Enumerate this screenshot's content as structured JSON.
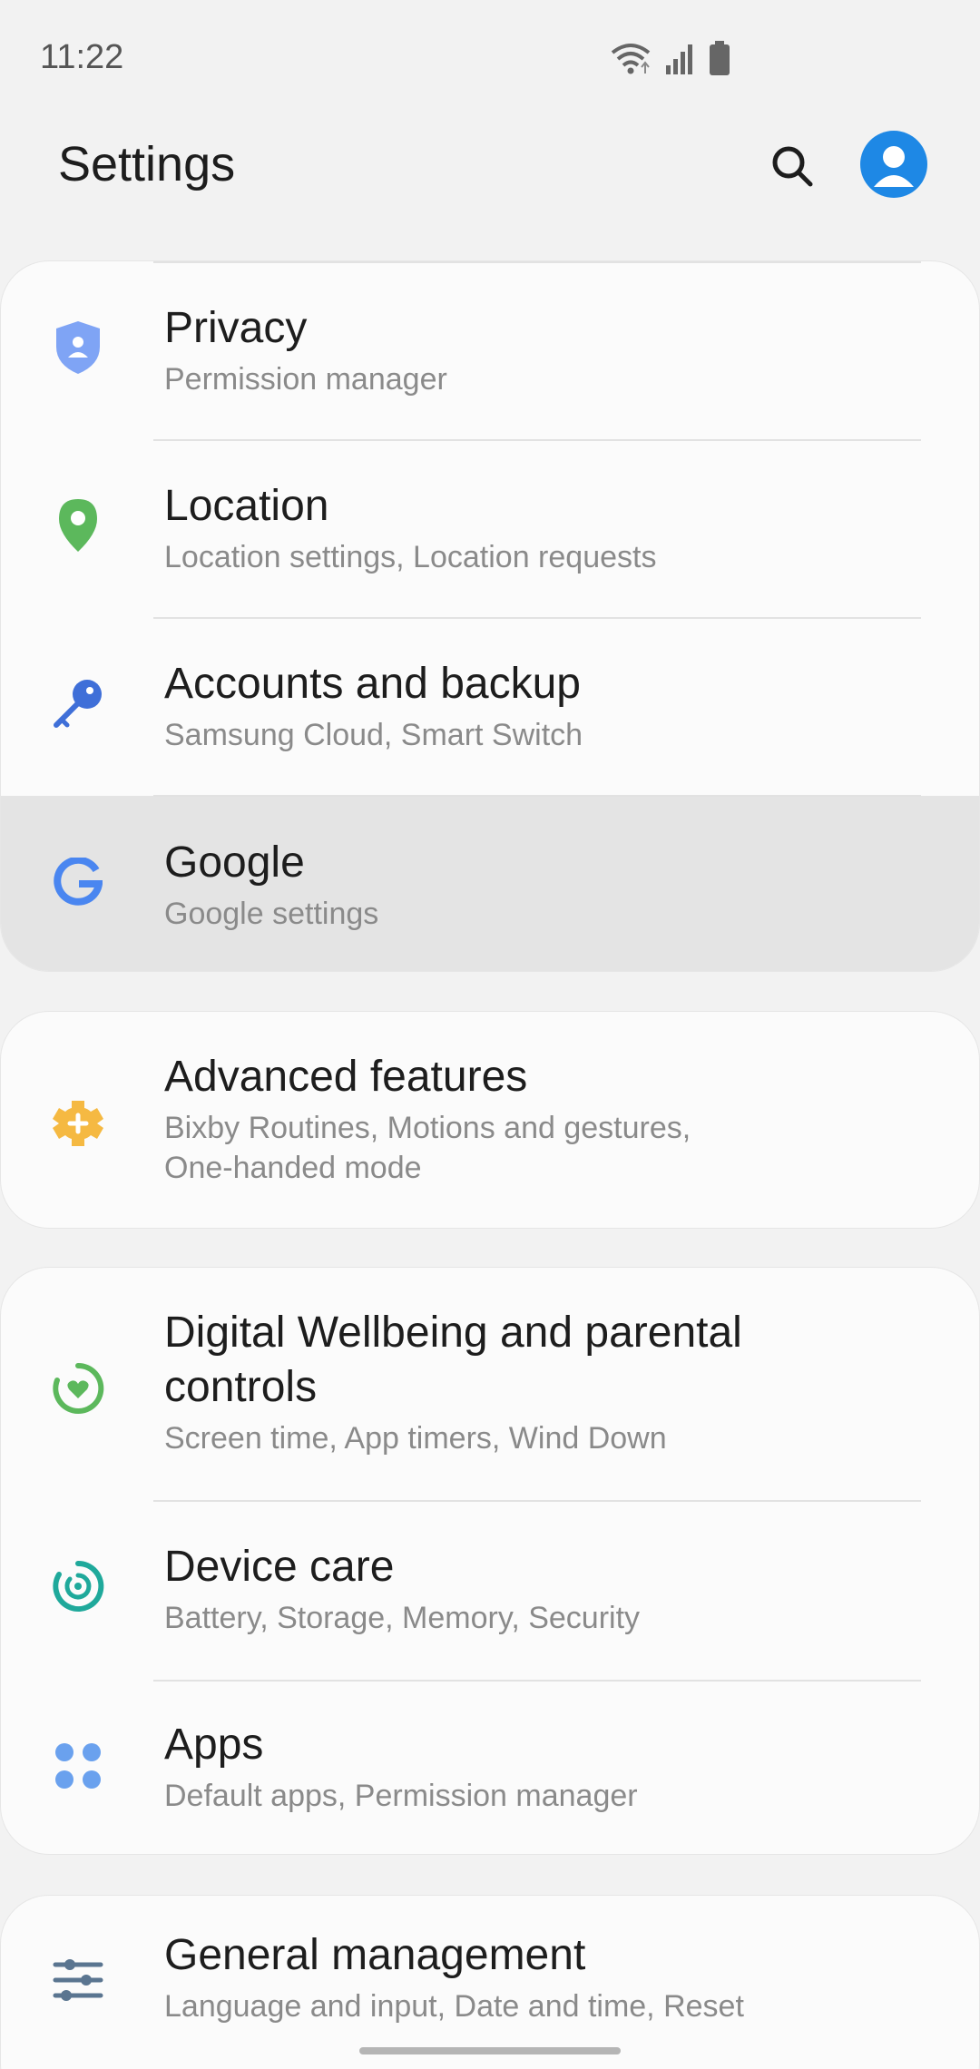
{
  "status_bar": {
    "time": "11:22",
    "icons": [
      "wifi-icon",
      "signal-icon",
      "battery-icon"
    ]
  },
  "header": {
    "title": "Settings",
    "search_icon": "search-icon",
    "avatar_icon": "profile-icon",
    "avatar_color": "#1e88e5"
  },
  "groups": [
    {
      "items": [
        {
          "title": "Privacy",
          "subtitle": "Permission manager",
          "icon": "privacy-shield-icon"
        },
        {
          "title": "Location",
          "subtitle": "Location settings, Location requests",
          "icon": "location-pin-icon"
        },
        {
          "title": "Accounts and backup",
          "subtitle": "Samsung Cloud, Smart Switch",
          "icon": "key-icon"
        },
        {
          "title": "Google",
          "subtitle": "Google settings",
          "icon": "google-icon"
        }
      ]
    },
    {
      "items": [
        {
          "title": "Advanced features",
          "subtitle": "Bixby Routines, Motions and gestures,",
          "subtitle2": "One-handed mode",
          "icon": "puzzle-gear-icon"
        }
      ]
    },
    {
      "items": [
        {
          "title": "Digital Wellbeing and parental",
          "title2": "controls",
          "subtitle": "Screen time, App timers, Wind Down",
          "icon": "wellbeing-icon"
        },
        {
          "title": "Device care",
          "subtitle": "Battery, Storage, Memory, Security",
          "icon": "device-care-icon"
        },
        {
          "title": "Apps",
          "subtitle": "Default apps, Permission manager",
          "icon": "apps-grid-icon"
        }
      ]
    },
    {
      "items": [
        {
          "title": "General management",
          "subtitle": "Language and input, Date and time, Reset",
          "icon": "sliders-icon"
        }
      ]
    }
  ]
}
